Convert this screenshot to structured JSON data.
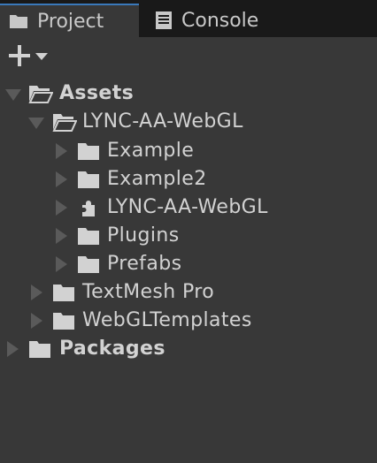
{
  "tabs": [
    {
      "label": "Project",
      "icon": "folder-icon",
      "active": true
    },
    {
      "label": "Console",
      "icon": "console-icon",
      "active": false
    }
  ],
  "toolbar": {
    "create_icon": "plus-icon",
    "dropdown_icon": "chevron-down-icon"
  },
  "tree": {
    "assets": {
      "label": "Assets"
    },
    "lync_folder": {
      "label": "LYNC-AA-WebGL"
    },
    "example": {
      "label": "Example"
    },
    "example2": {
      "label": "Example2"
    },
    "lync_asmdef": {
      "label": "LYNC-AA-WebGL"
    },
    "plugins": {
      "label": "Plugins"
    },
    "prefabs": {
      "label": "Prefabs"
    },
    "textmesh": {
      "label": "TextMesh Pro"
    },
    "webgltemplates": {
      "label": "WebGLTemplates"
    },
    "packages": {
      "label": "Packages"
    }
  },
  "colors": {
    "background": "#383838",
    "tabbar": "#191919",
    "active_tab_accent": "#3a79bb",
    "text": "#d2d2d2",
    "arrow": "#5a5a5a"
  }
}
